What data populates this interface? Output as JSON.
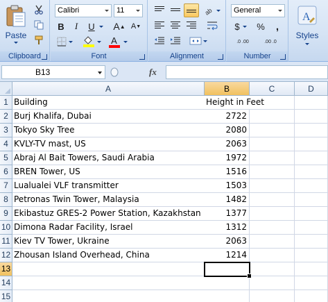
{
  "ribbon": {
    "clipboard": {
      "paste_label": "Paste",
      "group_label": "Clipboard"
    },
    "font": {
      "font_name": "Calibri",
      "font_size": "11",
      "bold_label": "B",
      "italic_label": "I",
      "underline_label": "U",
      "grow_label": "A",
      "shrink_label": "A",
      "font_color_label": "A",
      "group_label": "Font",
      "font_color": "#ff0000",
      "fill_color": "#ffff00"
    },
    "alignment": {
      "group_label": "Alignment"
    },
    "number": {
      "format": "General",
      "currency_label": "$",
      "percent_label": "%",
      "comma_label": ",",
      "inc_decimal_label": ".0 .00",
      "dec_decimal_label": ".00 .0",
      "group_label": "Number"
    },
    "styles": {
      "styles_label": "Styles",
      "styles_icon_label": "A"
    }
  },
  "formula_bar": {
    "name_box": "B13",
    "fx_label": "fx",
    "formula": ""
  },
  "sheet": {
    "columns": [
      "A",
      "B",
      "C",
      "D"
    ],
    "selected_column": "B",
    "selected_row": 13,
    "rows": [
      {
        "row": "1",
        "a": "Building",
        "b": "Height in Feet"
      },
      {
        "row": "2",
        "a": "Burj Khalifa, Dubai",
        "b": "2722"
      },
      {
        "row": "3",
        "a": "Tokyo Sky Tree",
        "b": "2080"
      },
      {
        "row": "4",
        "a": "KVLY-TV mast, US",
        "b": "2063"
      },
      {
        "row": "5",
        "a": "Abraj Al Bait Towers, Saudi Arabia",
        "b": "1972"
      },
      {
        "row": "6",
        "a": "BREN Tower, US",
        "b": "1516"
      },
      {
        "row": "7",
        "a": "Lualualei VLF transmitter",
        "b": "1503"
      },
      {
        "row": "8",
        "a": "Petronas Twin Tower, Malaysia",
        "b": "1482"
      },
      {
        "row": "9",
        "a": "Ekibastuz GRES-2 Power Station, Kazakhstan",
        "b": "1377"
      },
      {
        "row": "10",
        "a": "Dimona Radar Facility, Israel",
        "b": "1312"
      },
      {
        "row": "11",
        "a": "Kiev TV Tower, Ukraine",
        "b": "2063"
      },
      {
        "row": "12",
        "a": "Zhousan Island Overhead, China",
        "b": "1214"
      },
      {
        "row": "13",
        "a": "",
        "b": ""
      },
      {
        "row": "14",
        "a": "",
        "b": ""
      },
      {
        "row": "15",
        "a": "",
        "b": ""
      }
    ]
  }
}
